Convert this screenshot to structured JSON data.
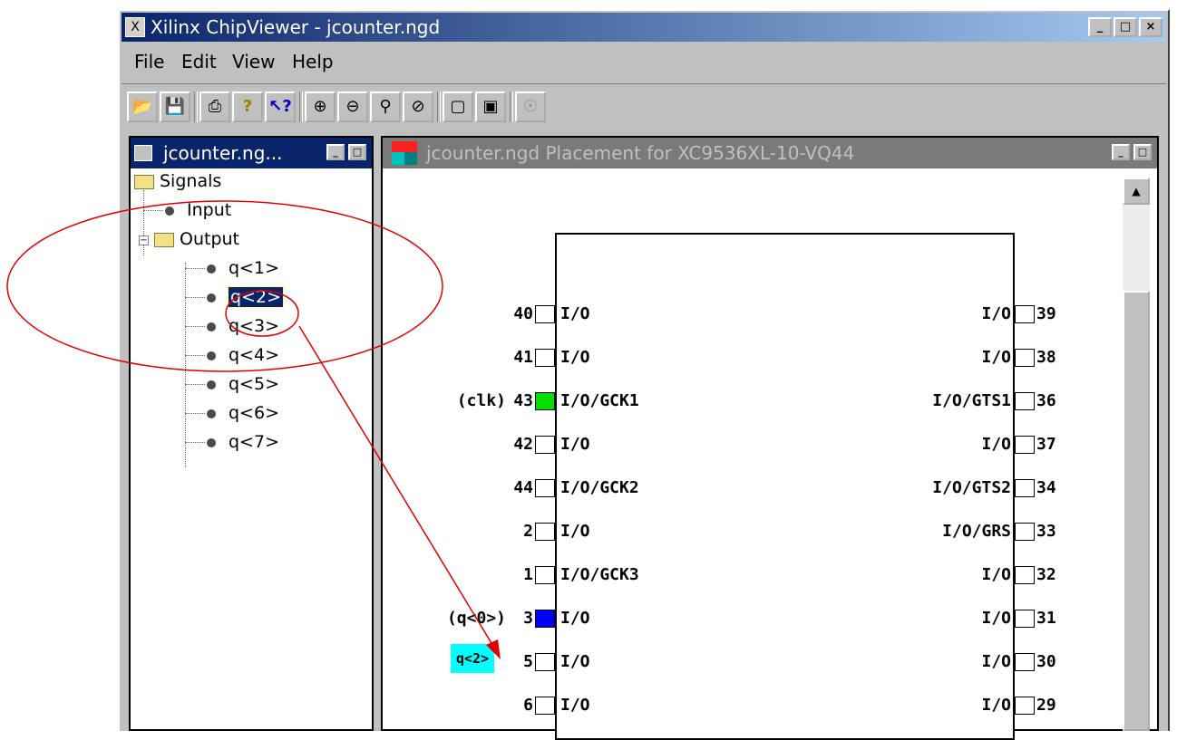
{
  "window": {
    "title": "Xilinx ChipViewer - jcounter.ngd",
    "app_icon": "X",
    "controls": [
      "_",
      "□",
      "×"
    ]
  },
  "menu": [
    "File",
    "Edit",
    "View",
    "Help"
  ],
  "toolbar": [
    "open-folder-icon",
    "save-disk-icon",
    "print-icon",
    "help-question-icon",
    "whats-this-icon",
    "zoom-in-icon",
    "zoom-out-icon",
    "zoom-fit-icon",
    "zoom-box-icon",
    "select-package-icon",
    "select-chip-icon",
    "disabled-tool-icon"
  ],
  "left_panel": {
    "title": "jcounter.ng...",
    "tree": {
      "root": "Signals",
      "input": "Input",
      "output": "Output",
      "outputs": [
        "q<1>",
        "q<2>",
        "q<3>",
        "q<4>",
        "q<5>",
        "q<6>",
        "q<7>"
      ],
      "selected": "q<2>"
    }
  },
  "right_panel": {
    "title": "jcounter.ngd Placement for XC9536XL-10-VQ44",
    "left_pins": [
      {
        "num": "40",
        "label": "I/O",
        "signal": "",
        "color": ""
      },
      {
        "num": "41",
        "label": "I/O",
        "signal": "",
        "color": ""
      },
      {
        "num": "43",
        "label": "I/O/GCK1",
        "signal": "(clk)",
        "color": "#00e000"
      },
      {
        "num": "42",
        "label": "I/O",
        "signal": "",
        "color": ""
      },
      {
        "num": "44",
        "label": "I/O/GCK2",
        "signal": "",
        "color": ""
      },
      {
        "num": "2",
        "label": "I/O",
        "signal": "",
        "color": ""
      },
      {
        "num": "1",
        "label": "I/O/GCK3",
        "signal": "",
        "color": ""
      },
      {
        "num": "3",
        "label": "I/O",
        "signal": "(q<0>)",
        "color": "#0000ff"
      },
      {
        "num": "5",
        "label": "I/O",
        "signal": "q<2>",
        "color": "",
        "highlight": "#00ffff"
      },
      {
        "num": "6",
        "label": "I/O",
        "signal": "",
        "color": ""
      }
    ],
    "right_pins": [
      {
        "num": "39",
        "label": "I/O"
      },
      {
        "num": "38",
        "label": "I/O"
      },
      {
        "num": "36",
        "label": "I/O/GTS1"
      },
      {
        "num": "37",
        "label": "I/O"
      },
      {
        "num": "34",
        "label": "I/O/GTS2"
      },
      {
        "num": "33",
        "label": "I/O/GRS"
      },
      {
        "num": "32",
        "label": "I/O"
      },
      {
        "num": "31",
        "label": "I/O"
      },
      {
        "num": "30",
        "label": "I/O"
      },
      {
        "num": "29",
        "label": "I/O"
      }
    ]
  },
  "annotations": {
    "circle_color": "#e00000",
    "arrow_color": "#e00000"
  }
}
